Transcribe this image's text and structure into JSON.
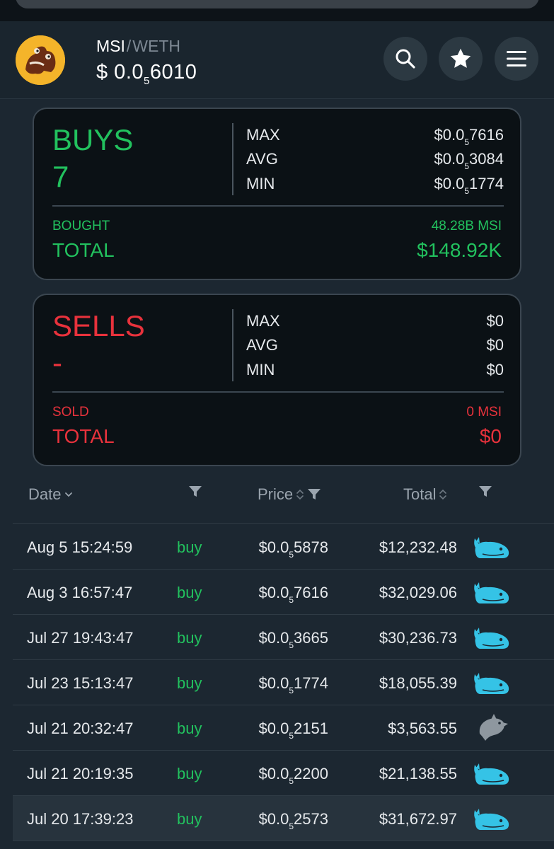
{
  "header": {
    "base_symbol": "MSI",
    "separator": "/",
    "quote_symbol": "WETH",
    "price_prefix": "$ 0.0",
    "price_zeros": "5",
    "price_digits": "6010",
    "accent_color": "#22c15e"
  },
  "buys": {
    "label": "BUYS",
    "count": "7",
    "stats": [
      {
        "key": "MAX",
        "prefix": "$0.0",
        "zeros": "5",
        "digits": "7616"
      },
      {
        "key": "AVG",
        "prefix": "$0.0",
        "zeros": "5",
        "digits": "3084"
      },
      {
        "key": "MIN",
        "prefix": "$0.0",
        "zeros": "5",
        "digits": "1774"
      }
    ],
    "sub_label": "BOUGHT",
    "sub_value": "48.28B MSI",
    "total_label": "TOTAL",
    "total_value": "$148.92K"
  },
  "sells": {
    "label": "SELLS",
    "count": "-",
    "stats": [
      {
        "key": "MAX",
        "value": "$0"
      },
      {
        "key": "AVG",
        "value": "$0"
      },
      {
        "key": "MIN",
        "value": "$0"
      }
    ],
    "sub_label": "SOLD",
    "sub_value": "0 MSI",
    "total_label": "TOTAL",
    "total_value": "$0"
  },
  "table": {
    "headers": {
      "date": "Date",
      "price": "Price",
      "total": "Total"
    },
    "rows": [
      {
        "date": "Aug 5 15:24:59",
        "type": "buy",
        "price_prefix": "$0.0",
        "price_zeros": "5",
        "price_digits": "5878",
        "total": "$12,232.48",
        "icon": "whale-icon"
      },
      {
        "date": "Aug 3 16:57:47",
        "type": "buy",
        "price_prefix": "$0.0",
        "price_zeros": "5",
        "price_digits": "7616",
        "total": "$32,029.06",
        "icon": "whale-icon"
      },
      {
        "date": "Jul 27 19:43:47",
        "type": "buy",
        "price_prefix": "$0.0",
        "price_zeros": "5",
        "price_digits": "3665",
        "total": "$30,236.73",
        "icon": "whale-icon"
      },
      {
        "date": "Jul 23 15:13:47",
        "type": "buy",
        "price_prefix": "$0.0",
        "price_zeros": "5",
        "price_digits": "1774",
        "total": "$18,055.39",
        "icon": "whale-icon"
      },
      {
        "date": "Jul 21 20:32:47",
        "type": "buy",
        "price_prefix": "$0.0",
        "price_zeros": "5",
        "price_digits": "2151",
        "total": "$3,563.55",
        "icon": "dolphin-icon"
      },
      {
        "date": "Jul 21 20:19:35",
        "type": "buy",
        "price_prefix": "$0.0",
        "price_zeros": "5",
        "price_digits": "2200",
        "total": "$21,138.55",
        "icon": "whale-icon"
      },
      {
        "date": "Jul 20 17:39:23",
        "type": "buy",
        "price_prefix": "$0.0",
        "price_zeros": "5",
        "price_digits": "2573",
        "total": "$31,672.97",
        "icon": "whale-icon"
      }
    ]
  }
}
